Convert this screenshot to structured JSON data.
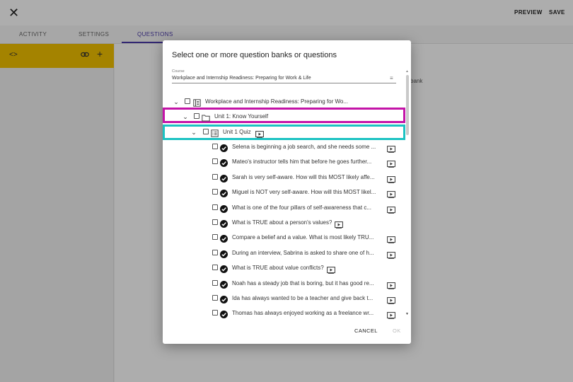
{
  "topbar": {
    "close_icon": "close-icon",
    "preview_label": "PREVIEW",
    "save_label": "SAVE"
  },
  "tabs": [
    {
      "label": "ACTIVITY"
    },
    {
      "label": "SETTINGS"
    },
    {
      "label": "QUESTIONS",
      "active": true
    }
  ],
  "leftpanel": {
    "icons": [
      "code-icon",
      "link-icon",
      "add-icon"
    ]
  },
  "background_hint": "bank",
  "dialog": {
    "title": "Select one or more question banks or questions",
    "course_label": "Course",
    "course_value": "Workplace and Internship Readiness: Preparing for Work & Life",
    "cancel_label": "CANCEL",
    "ok_label": "OK",
    "tree": {
      "course": "Workplace and Internship Readiness: Preparing for Wo...",
      "unit": "Unit 1: Know Yourself",
      "quiz": "Unit 1 Quiz",
      "questions": [
        "Selena is beginning a job search, and she needs some ...",
        "Mateo's instructor tells him that before he goes further...",
        "Sarah is very self-aware. How will this MOST likely affe...",
        "Miguel is NOT very self-aware. How will this MOST likel...",
        "What is one of the four pillars of self-awareness that c...",
        "What is TRUE about a person's values?",
        "Compare a belief and a value. What is most likely TRU...",
        "During an interview, Sabrina is asked to share one of h...",
        "What is TRUE about value conflicts?",
        "Noah has a steady job that is boring, but it has good re...",
        "Ida has always wanted to be a teacher and give back t...",
        "Thomas has always enjoyed working as a freelance wr..."
      ]
    }
  },
  "colors": {
    "accent": "#4a3aa8",
    "yellow": "#f2c200",
    "highlight_pink": "#c414a8",
    "highlight_teal": "#1bc2c2"
  }
}
